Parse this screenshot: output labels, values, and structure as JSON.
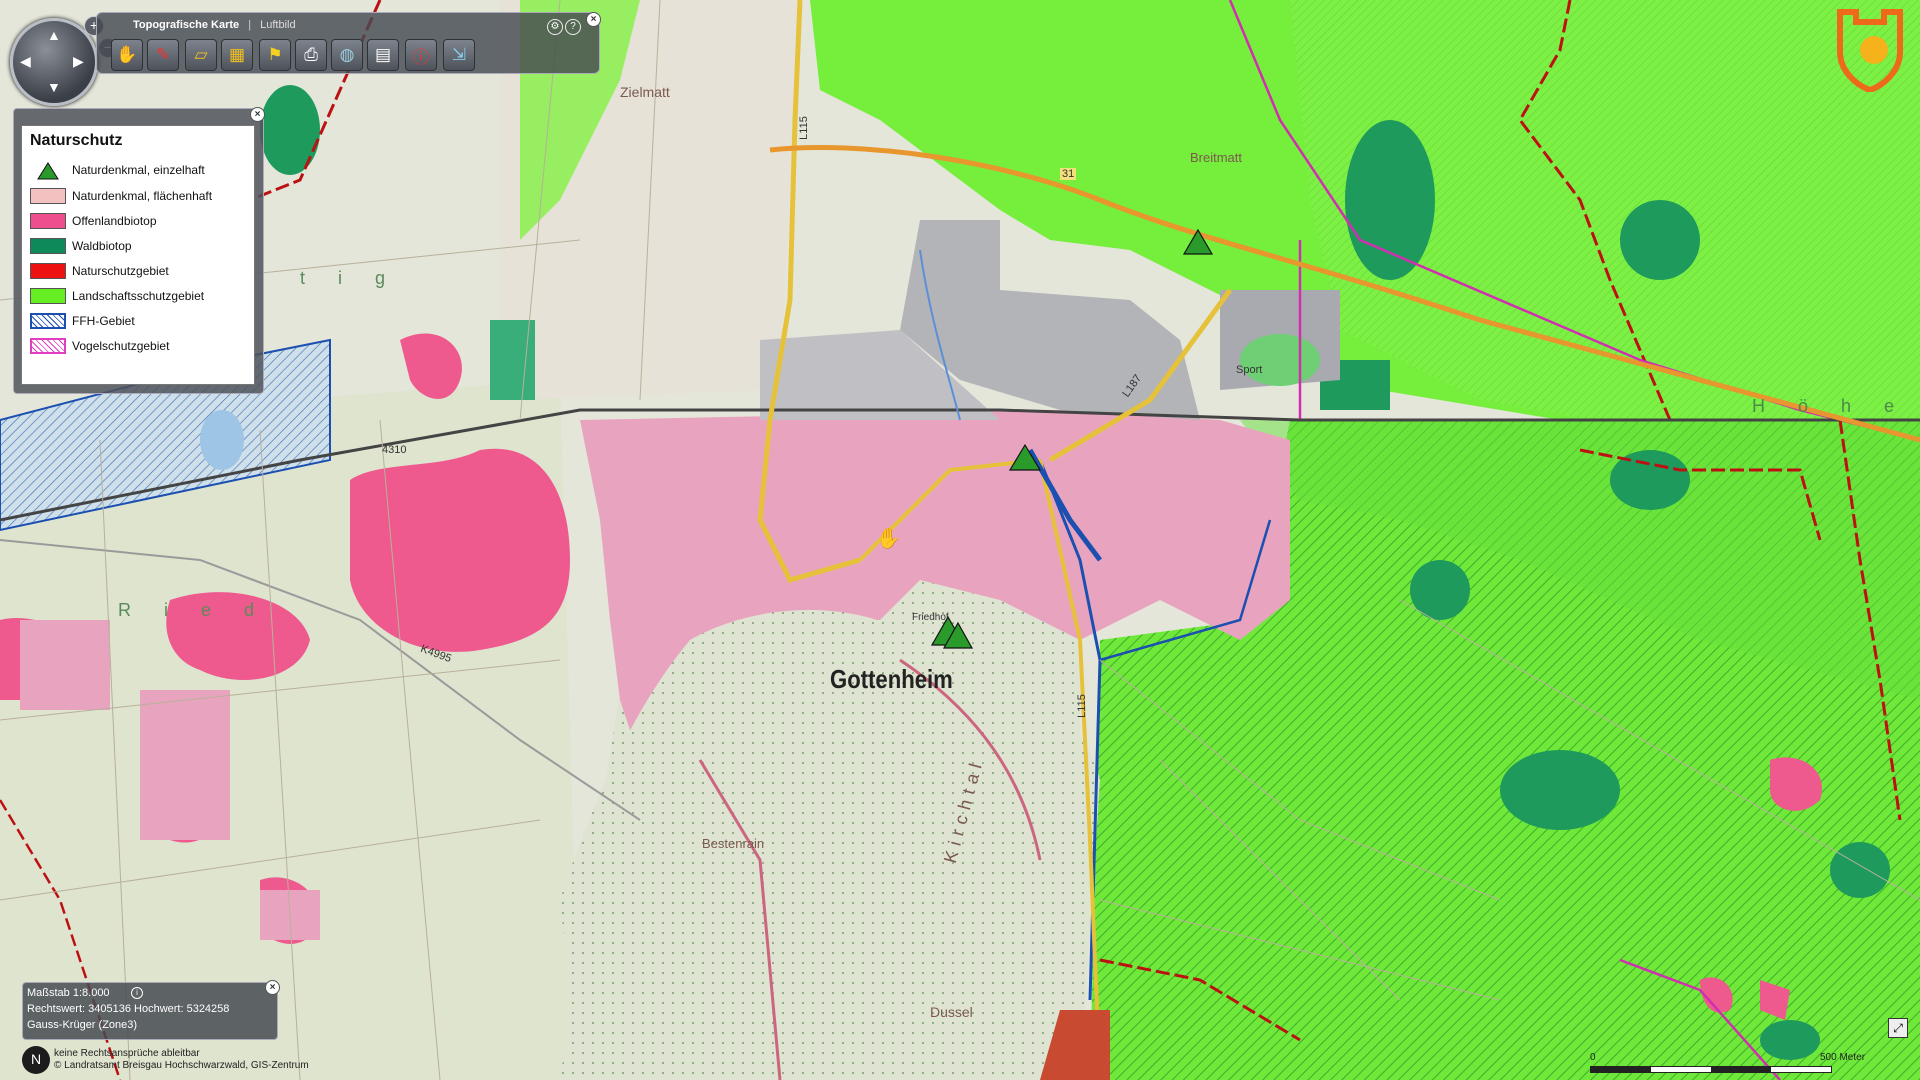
{
  "toolbar": {
    "tab_topo": "Topografische Karte",
    "tab_separator": "|",
    "tab_aerial": "Luftbild",
    "settings_icon": "settings-icon",
    "help_label": "?",
    "buttons": [
      "pan-tool-icon",
      "measure-line-icon",
      "measure-area-icon",
      "select-tool-icon",
      "flag-marker-icon",
      "print-icon",
      "globe-icon",
      "document-icon",
      "info-icon",
      "export-icon"
    ]
  },
  "navigation": {
    "zoom_in": "+",
    "zoom_out": "−"
  },
  "legend": {
    "title": "Naturschutz",
    "items": [
      {
        "label": "Naturdenkmal, einzelhaft",
        "color": "#2a9a2a"
      },
      {
        "label": "Naturdenkmal, flächenhaft",
        "color": "#f3c2c0"
      },
      {
        "label": "Offenlandbiotop",
        "color": "#ee4e8c"
      },
      {
        "label": "Waldbiotop",
        "color": "#0e8a5a"
      },
      {
        "label": "Naturschutzgebiet",
        "color": "#ee1111"
      },
      {
        "label": "Landschaftsschutzgebiet",
        "color": "#66ee22"
      },
      {
        "label": "FFH-Gebiet",
        "color": "#1b4fb0"
      },
      {
        "label": "Vogelschutzgebiet",
        "color": "#e040c0"
      }
    ]
  },
  "scale": {
    "scale_text": "Maßstab 1:8.000",
    "coords_text": "Rechtswert: 3405136 Hochwert: 5324258",
    "system_text": "Gauss-Krüger (Zone3)"
  },
  "credit": {
    "north": "N",
    "line1": "keine Rechtsansprüche ableitbar",
    "line2": "© Landratsamt Breisgau Hochschwarzwald, GIS-Zentrum"
  },
  "scalebar": {
    "start": "0",
    "end": "500 Meter"
  },
  "map_labels": {
    "town": "Gottenheim",
    "zielmatt": "Zielmatt",
    "breitmatt": "Breitmatt",
    "bestenrain": "Bestenrain",
    "dussel": "Dussel",
    "kirchtal": "Kirchtal",
    "ried": "R i e d",
    "tig": "t i g",
    "hoehe": "H ö h e",
    "sport": "Sport",
    "road_l115": "L115",
    "road_l187": "L187",
    "road_31": "31",
    "road_4310": "4310",
    "road_k4995": "K4995",
    "road_l115b": "L115",
    "friedhof": "Friedhof"
  },
  "colors": {
    "landscape_protection": "#76ee3c",
    "landscape_protection_dark": "#5fd42e",
    "settlement": "#e8a4bf",
    "biotope_open": "#ee5a8e",
    "forest_biotope": "#129058",
    "nature_reserve_border": "#bb1111",
    "ffh_border": "#1b4fb0",
    "bird_border": "#d030b0",
    "road_yellow": "#e6c23a",
    "road_orange": "#e8962e",
    "railway": "#444444"
  }
}
